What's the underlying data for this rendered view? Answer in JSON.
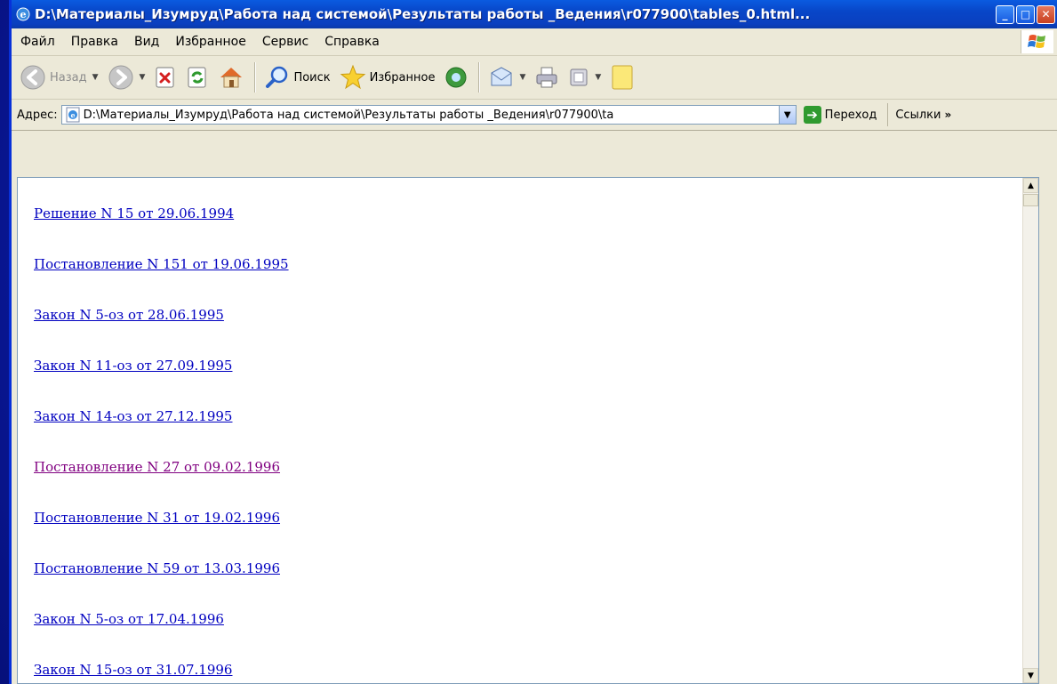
{
  "window": {
    "title": "D:\\Материалы_Изумруд\\Работа над системой\\Результаты работы _Ведения\\r077900\\tables_0.html...",
    "minimize": "_",
    "maximize": "□",
    "close": "✕"
  },
  "menu": [
    "Файл",
    "Правка",
    "Вид",
    "Избранное",
    "Сервис",
    "Справка"
  ],
  "toolbar": {
    "back_label": "Назад",
    "search_label": "Поиск",
    "favorites_label": "Избранное"
  },
  "address": {
    "label": "Адрес:",
    "value": "D:\\Материалы_Изумруд\\Работа над системой\\Результаты работы _Ведения\\r077900\\ta",
    "go_label": "Переход",
    "links_label": "Ссылки",
    "links_more": "»"
  },
  "page": {
    "links": [
      {
        "text": "Решение N 15 от 29.06.1994",
        "visited": false
      },
      {
        "text": "Постановление N 151 от 19.06.1995",
        "visited": false
      },
      {
        "text": "Закон N 5-оз от 28.06.1995",
        "visited": false
      },
      {
        "text": "Закон N 11-оз от 27.09.1995",
        "visited": false
      },
      {
        "text": "Закон N 14-оз от 27.12.1995",
        "visited": false
      },
      {
        "text": "Постановление N 27 от 09.02.1996",
        "visited": true
      },
      {
        "text": "Постановление N 31 от 19.02.1996",
        "visited": false
      },
      {
        "text": "Постановление N 59 от 13.03.1996",
        "visited": false
      },
      {
        "text": "Закон N 5-оз от 17.04.1996",
        "visited": false
      },
      {
        "text": "Закон N 15-оз от 31.07.1996",
        "visited": false
      }
    ]
  },
  "colors": {
    "link": "#0000c0",
    "visited_link": "#800080",
    "titlebar": "#0a46c8"
  }
}
